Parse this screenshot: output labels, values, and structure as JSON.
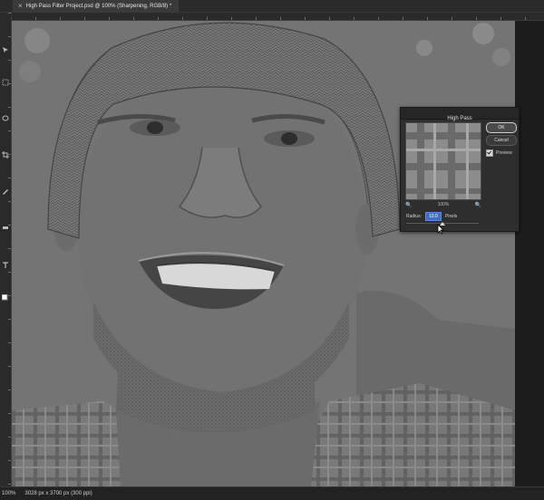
{
  "document": {
    "tab_title": "High Pass Filter Project.psd @ 100% (Sharpening, RGB/8) *",
    "close_glyph": "×"
  },
  "status_bar": {
    "zoom": "100%",
    "info": "3028 px x 3700 px (300 ppi)"
  },
  "high_pass_dialog": {
    "title": "High Pass",
    "zoom_level": "100%",
    "zoom_out_glyph": "🔍",
    "zoom_in_glyph": "🔍",
    "radius_label": "Radius:",
    "radius_value": "10.0",
    "radius_unit": "Pixels",
    "radius_slider_fraction": 0.5,
    "ok_label": "OK",
    "cancel_label": "Cancel",
    "preview_label": "Preview",
    "preview_checked": true
  },
  "colors": {
    "canvas_gray": "#6e6e6e",
    "ui_dark": "#2e2e2e",
    "accent_blue": "#3f6fc4"
  }
}
